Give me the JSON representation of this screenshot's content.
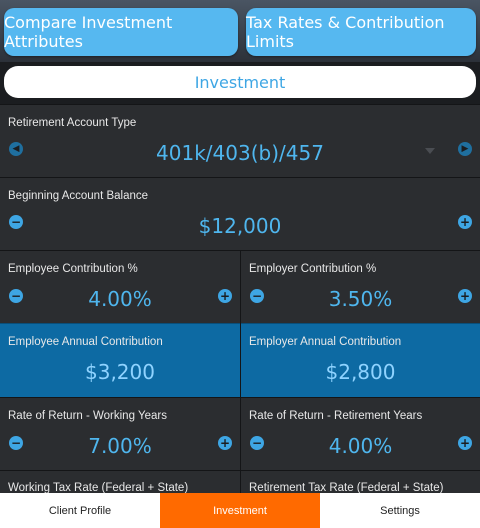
{
  "top_buttons": {
    "compare": "Compare Investment Attributes",
    "tax": "Tax Rates & Contribution Limits"
  },
  "section_title": "Investment",
  "retirement_account": {
    "label": "Retirement Account Type",
    "value": "401k/403(b)/457"
  },
  "beginning_balance": {
    "label": "Beginning Account Balance",
    "value": "$12,000"
  },
  "employee_contribution_pct": {
    "label": "Employee Contribution %",
    "value": "4.00%"
  },
  "employer_contribution_pct": {
    "label": "Employer Contribution %",
    "value": "3.50%"
  },
  "employee_annual": {
    "label": "Employee Annual Contribution",
    "value": "$3,200"
  },
  "employer_annual": {
    "label": "Employer Annual Contribution",
    "value": "$2,800"
  },
  "ror_working": {
    "label": "Rate of Return - Working Years",
    "value": "7.00%"
  },
  "ror_retirement": {
    "label": "Rate of Return - Retirement Years",
    "value": "4.00%"
  },
  "tax_working": {
    "label": "Working Tax Rate (Federal + State)"
  },
  "tax_retirement": {
    "label": "Retirement Tax Rate (Federal + State)"
  },
  "bottom_nav": {
    "tabs": [
      "Client Profile",
      "Investment",
      "Settings"
    ],
    "active": "Investment"
  },
  "colors": {
    "accent": "#3ea6e4",
    "highlight_panel": "#0d6aa3",
    "active_tab": "#ff6a00"
  }
}
